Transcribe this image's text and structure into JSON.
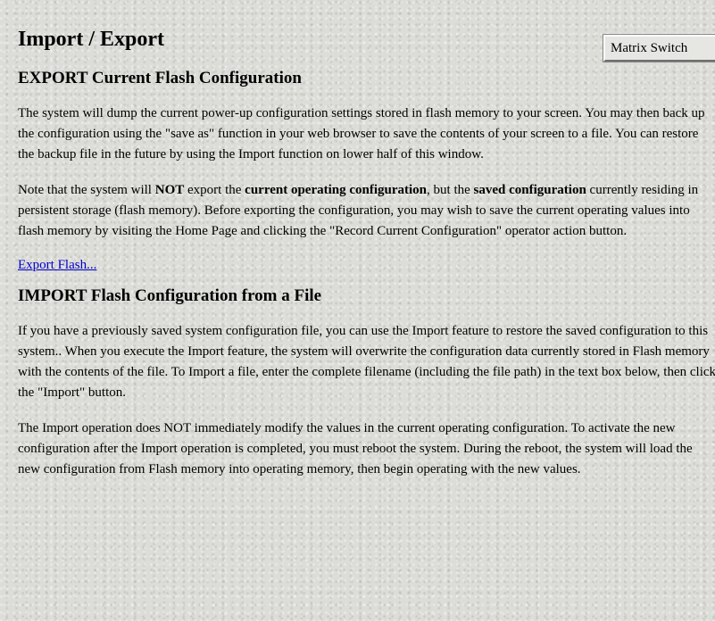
{
  "page": {
    "title": "Import / Export",
    "matrix_switch_button": "Matrix Switch"
  },
  "export_section": {
    "heading": "EXPORT Current Flash Configuration",
    "para1": "The system will dump the current power-up configuration settings stored in flash memory to your screen. You may then back up the configuration using the \"save as\" function in your web browser to save the contents of your screen to a file. You can restore the backup file in the future by using the Import function on lower half of this window.",
    "para2_part1": "Note that the system will ",
    "para2_not": "NOT",
    "para2_part2": " export the ",
    "para2_current": "current operating configuration",
    "para2_part3": ", but the ",
    "para2_saved": "saved configuration",
    "para2_part4": " currently residing in persistent storage (flash memory). Before exporting the configuration, you may wish to save the current operating values into flash memory by visiting the Home Page and clicking the \"Record Current Configuration\" operator action button.",
    "export_link": "Export Flash..."
  },
  "import_section": {
    "heading": "IMPORT Flash Configuration from a File",
    "para1": "If you have a previously saved system configuration file, you can use the Import feature to restore the saved configuration to this system.. When you execute the Import feature, the system will overwrite the configuration data currently stored in Flash memory with the contents of the file. To Import a file, enter the complete filename (including the file path) in the text box below, then click the \"Import\" button.",
    "para2": "The Import operation does NOT immediately modify the values in the current operating configuration. To activate the new configuration after the Import operation is completed, you must reboot the system. During the reboot, the system will load the new configuration from Flash memory into operating memory, then begin operating with the new values."
  },
  "colors": {
    "background": "#dcdcd8",
    "link": "#0000cc"
  }
}
